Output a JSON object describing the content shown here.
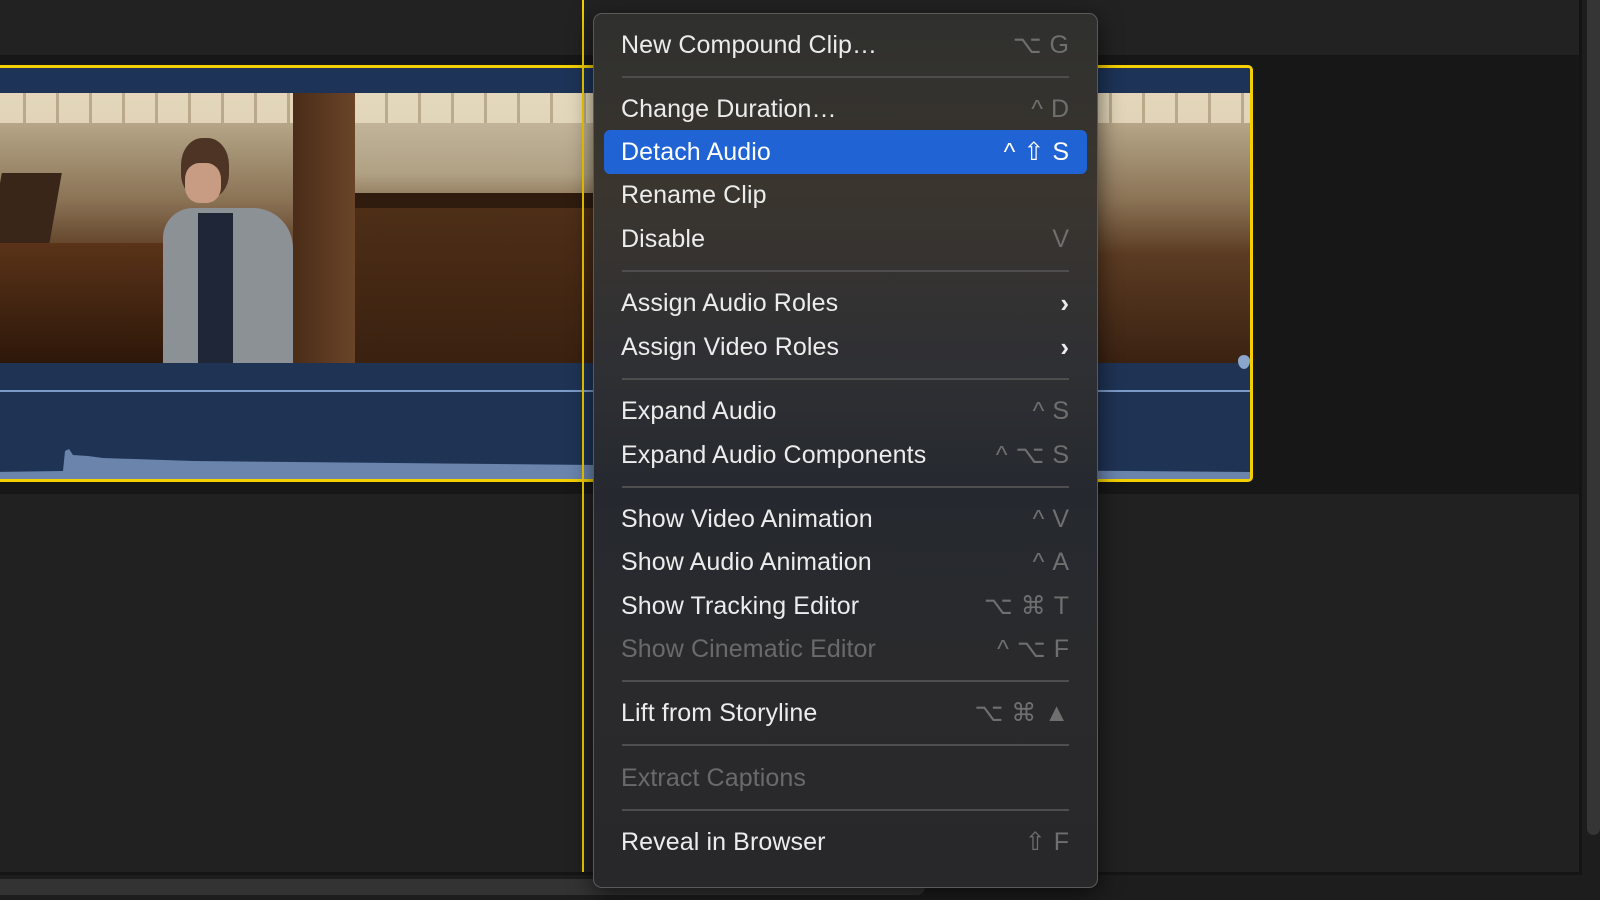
{
  "app": "Final Cut Pro timeline",
  "colors": {
    "selection_border": "#f5d000",
    "playhead": "#f5d000",
    "clip_blue": "#1f3355",
    "menu_highlight": "#1f63d4",
    "waveform": "#6a84ac"
  },
  "clip": {
    "thumbnails": [
      "pianist-playing-organ",
      "church-interior-piano",
      "pianist-hands-on-keys"
    ],
    "selected": true
  },
  "context_menu": {
    "items": [
      {
        "label": "New Compound Clip…",
        "shortcut": [
          "⌥",
          "G"
        ],
        "enabled": true,
        "highlighted": false
      },
      {
        "separator": true
      },
      {
        "label": "Change Duration…",
        "shortcut": [
          "^",
          "D"
        ],
        "enabled": true,
        "highlighted": false
      },
      {
        "label": "Detach Audio",
        "shortcut": [
          "^",
          "⇧",
          "S"
        ],
        "enabled": true,
        "highlighted": true
      },
      {
        "label": "Rename Clip",
        "shortcut": [],
        "enabled": true,
        "highlighted": false
      },
      {
        "label": "Disable",
        "shortcut": [
          "V"
        ],
        "enabled": true,
        "highlighted": false
      },
      {
        "separator": true
      },
      {
        "label": "Assign Audio Roles",
        "submenu": true,
        "enabled": true,
        "highlighted": false
      },
      {
        "label": "Assign Video Roles",
        "submenu": true,
        "enabled": true,
        "highlighted": false
      },
      {
        "separator": true
      },
      {
        "label": "Expand Audio",
        "shortcut": [
          "^",
          "S"
        ],
        "enabled": true,
        "highlighted": false
      },
      {
        "label": "Expand Audio Components",
        "shortcut": [
          "^",
          "⌥",
          "S"
        ],
        "enabled": true,
        "highlighted": false
      },
      {
        "separator": true
      },
      {
        "label": "Show Video Animation",
        "shortcut": [
          "^",
          "V"
        ],
        "enabled": true,
        "highlighted": false
      },
      {
        "label": "Show Audio Animation",
        "shortcut": [
          "^",
          "A"
        ],
        "enabled": true,
        "highlighted": false
      },
      {
        "label": "Show Tracking Editor",
        "shortcut": [
          "⌥",
          "⌘",
          "T"
        ],
        "enabled": true,
        "highlighted": false
      },
      {
        "label": "Show Cinematic Editor",
        "shortcut": [
          "^",
          "⌥",
          "F"
        ],
        "enabled": false,
        "highlighted": false
      },
      {
        "separator": true
      },
      {
        "label": "Lift from Storyline",
        "shortcut": [
          "⌥",
          "⌘",
          "▲"
        ],
        "enabled": true,
        "highlighted": false
      },
      {
        "separator": true
      },
      {
        "label": "Extract Captions",
        "shortcut": [],
        "enabled": false,
        "highlighted": false
      },
      {
        "separator": true
      },
      {
        "label": "Reveal in Browser",
        "shortcut": [
          "⇧",
          "F"
        ],
        "enabled": true,
        "highlighted": false
      }
    ],
    "submenu_icon": "chevron-right-icon"
  }
}
